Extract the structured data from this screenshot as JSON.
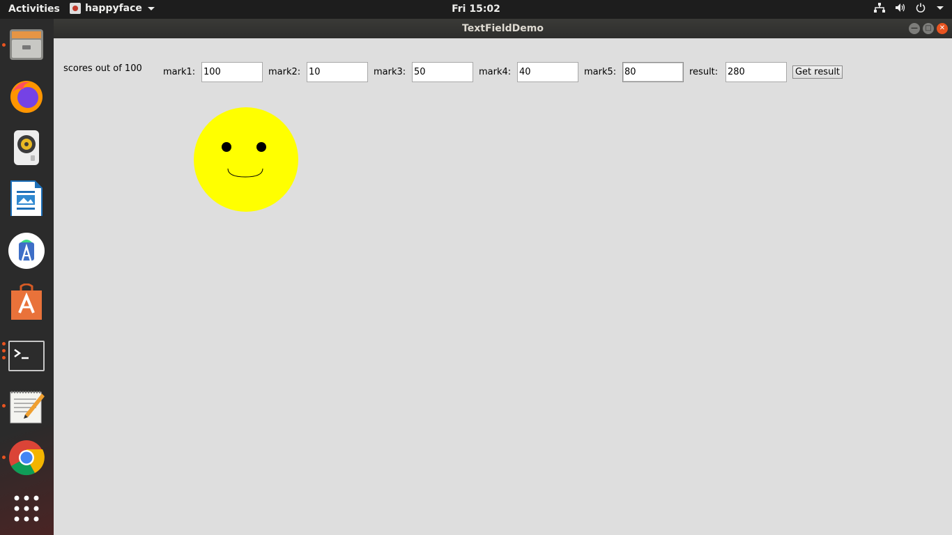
{
  "topbar": {
    "activities": "Activities",
    "app_name": "happyface",
    "clock": "Fri 15:02"
  },
  "dock": {
    "items": [
      {
        "name": "files-icon",
        "running": true
      },
      {
        "name": "firefox-icon",
        "running": false
      },
      {
        "name": "rhythmbox-icon",
        "running": false
      },
      {
        "name": "libreoffice-writer-icon",
        "running": false
      },
      {
        "name": "android-studio-icon",
        "running": false
      },
      {
        "name": "software-center-icon",
        "running": false
      },
      {
        "name": "terminal-icon",
        "running": true
      },
      {
        "name": "text-editor-icon",
        "running": true
      },
      {
        "name": "chrome-icon",
        "running": true
      },
      {
        "name": "show-apps-icon",
        "running": false
      }
    ]
  },
  "window": {
    "title": "TextFieldDemo",
    "heading": "scores out of 100",
    "fields": [
      {
        "label": "mark1:",
        "value": "100"
      },
      {
        "label": "mark2:",
        "value": "10"
      },
      {
        "label": "mark3:",
        "value": "50"
      },
      {
        "label": "mark4:",
        "value": "40"
      },
      {
        "label": "mark5:",
        "value": "80"
      }
    ],
    "result_label": "result:",
    "result_value": "280",
    "button_label": "Get result",
    "face_color": "#ffff00"
  }
}
